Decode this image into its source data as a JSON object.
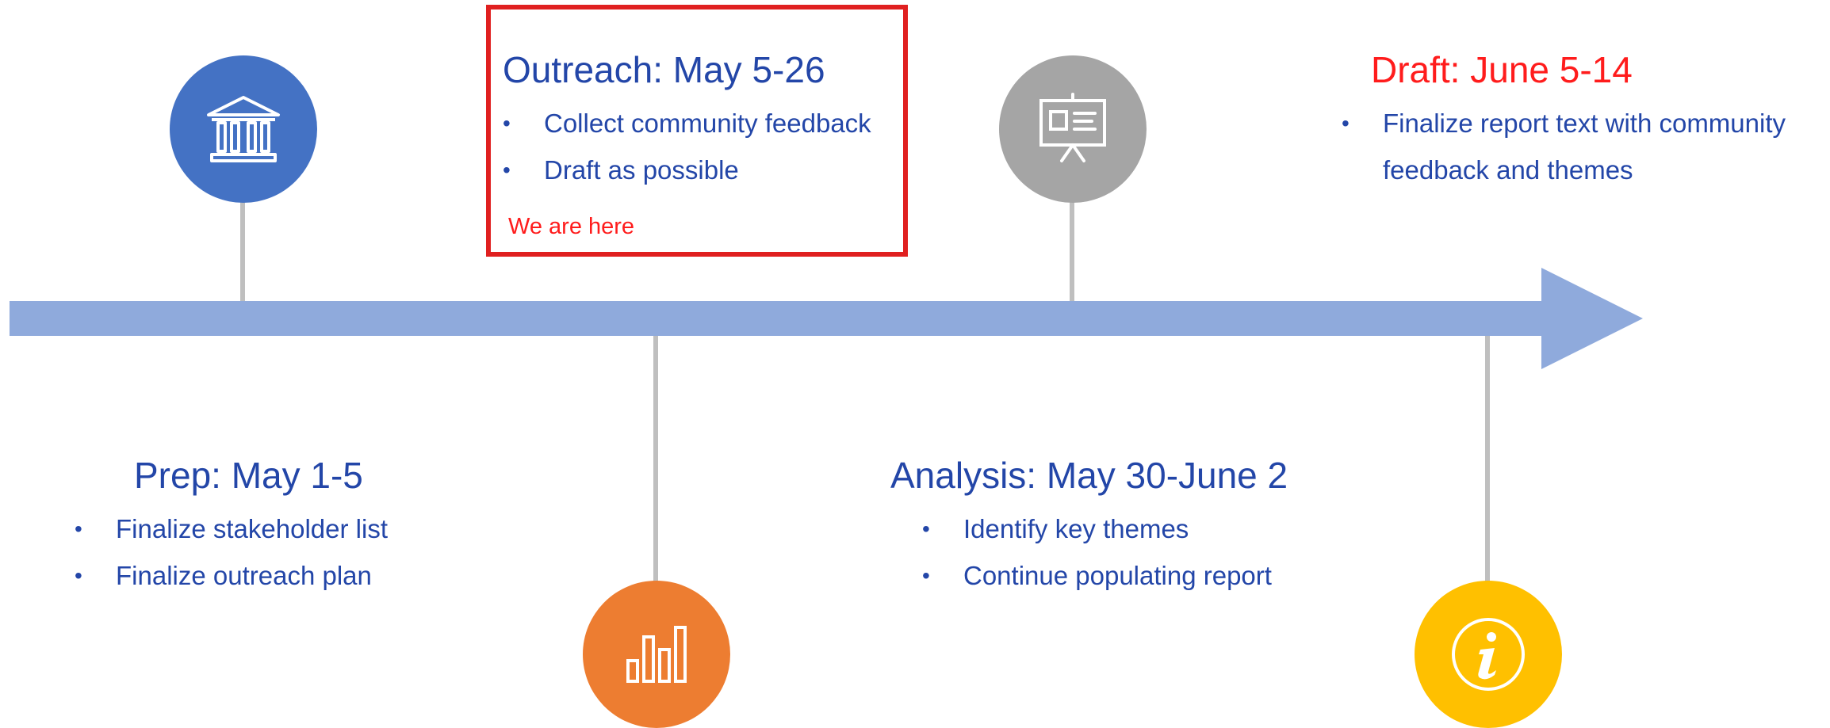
{
  "colors": {
    "arrow": "#8faadc",
    "stem": "#bfbfbf",
    "text": "#2346a8",
    "highlight": "#ff1c1c",
    "prep_circle": "#4472c4",
    "outreach_circle": "#ed7d31",
    "analysis_circle": "#a5a5a5",
    "draft_circle": "#ffc000"
  },
  "stages": {
    "prep": {
      "title": "Prep: May 1-5",
      "icon": "bank-building-icon",
      "bullets": [
        "Finalize stakeholder list",
        "Finalize outreach plan"
      ]
    },
    "outreach": {
      "title": "Outreach: May 5-26",
      "icon": "bar-chart-icon",
      "bullets": [
        "Collect community feedback",
        "Draft as possible"
      ],
      "callout": "We are here"
    },
    "analysis": {
      "title": "Analysis: May 30-June 2",
      "icon": "presentation-board-icon",
      "bullets": [
        "Identify key themes",
        "Continue populating report"
      ]
    },
    "draft": {
      "title": "Draft: June 5-14",
      "icon": "info-icon",
      "bullets": [
        "Finalize report text with community feedback and themes"
      ]
    }
  }
}
